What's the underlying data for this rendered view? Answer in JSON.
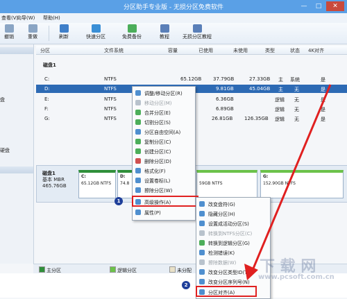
{
  "window": {
    "title": "分区助手专业版 - 无损分区免费软件",
    "min": "—",
    "max": "□",
    "close": "✕"
  },
  "menubar": [
    "查看(V)",
    "向导(W)",
    "帮助(H)"
  ],
  "toolbar": [
    {
      "label": "撤销"
    },
    {
      "label": "重做"
    },
    {
      "label": "刷新"
    },
    {
      "label": "快速分区"
    },
    {
      "label": "免费备份"
    },
    {
      "label": "教程"
    },
    {
      "label": "无损分区教程"
    }
  ],
  "left_panel": {
    "items": [
      "盘",
      "硬盘"
    ]
  },
  "table": {
    "headers": [
      "分区",
      "文件系统",
      "容量",
      "已使用",
      "未使用",
      "类型",
      "状态",
      "4K对齐"
    ],
    "disk_label": "磁盘1",
    "rows": [
      {
        "part": "C:",
        "fs": "NTFS",
        "cap": "65.12GB",
        "used": "37.79GB",
        "free": "27.33GB",
        "type": "主",
        "status": "系统",
        "align": "是"
      },
      {
        "part": "D:",
        "fs": "NTFS",
        "cap": "",
        "used": "9.81GB",
        "free": "45.04GB",
        "type": "主",
        "status": "无",
        "align": "是"
      },
      {
        "part": "E:",
        "fs": "NTFS",
        "cap": "",
        "used": "6.36GB",
        "free": "",
        "type": "逻辑",
        "status": "无",
        "align": "是"
      },
      {
        "part": "F:",
        "fs": "NTFS",
        "cap": "",
        "used": "6.89GB",
        "free": "",
        "type": "逻辑",
        "status": "无",
        "align": "是"
      },
      {
        "part": "G:",
        "fs": "NTFS",
        "cap": "",
        "used": "26.81GB",
        "free": "126.35GB",
        "type": "逻辑",
        "status": "无",
        "align": "是"
      }
    ]
  },
  "diskmap": {
    "disk": "磁盘1",
    "kind": "基本 MBR",
    "size": "465.76GB",
    "parts": [
      {
        "name": "C:",
        "detail": "65.12GB NTFS"
      },
      {
        "name": "D:",
        "detail": "74.8"
      },
      {
        "name": "",
        "detail": "59GB NTFS"
      },
      {
        "name": "G:",
        "detail": "152.90GB NTFS"
      }
    ]
  },
  "context_menu": [
    "调整/移动分区(R)",
    "移动分区(M)",
    "合并分区(E)",
    "切割分区(S)",
    "分区自由空间(A)",
    "复制分区(C)",
    "创建分区(C)",
    "删除分区(D)",
    "格式化(F)",
    "设置卷标(L)",
    "擦除分区(W)",
    "高级操作(A)",
    "属性(P)"
  ],
  "submenu": [
    "改变盘符(G)",
    "隐藏分区(H)",
    "设置成活动分区(S)",
    "转换到NTFS分区(C)",
    "转换到逻辑分区(G)",
    "检测错误(K)",
    "擦除数据(W)",
    "改变分区类型ID(T)",
    "改变分区序列号(N)",
    "分区对齐(A)"
  ],
  "legend": [
    "主分区",
    "逻辑分区",
    "未分配"
  ],
  "annotations": {
    "badge1": "1",
    "badge2": "2"
  },
  "watermark": {
    "main": "下 载 网",
    "url": "www.pcsoft.com.cn"
  },
  "colors": {
    "title": "#5aa0e6",
    "selected": "#2d6ab4",
    "primary": "#2f8f3a",
    "logical": "#6cc24a",
    "arrow": "#e02020"
  }
}
